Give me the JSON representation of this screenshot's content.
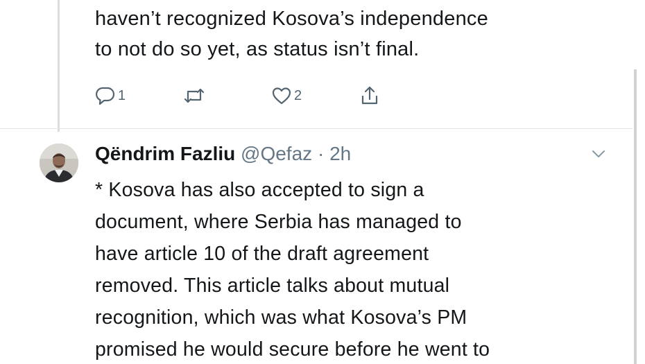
{
  "previous_tweet": {
    "lines": [
      "haven’t recognized Kosova’s independence",
      "to not do so yet, as status isn’t final."
    ],
    "actions": {
      "reply_count": "1",
      "retweet_count": "",
      "like_count": "2"
    }
  },
  "tweet": {
    "author_name": "Qëndrim Fazliu",
    "author_handle": "@Qefaz",
    "separator": " · ",
    "time": "2h",
    "lines": [
      "* Kosova has also accepted to sign a",
      "document, where Serbia has managed to",
      "have article 10 of the draft agreement",
      "removed. This article talks about mutual",
      "recognition, which was what Kosova’s PM",
      "promised he would secure before he went to"
    ]
  },
  "icons": {
    "reply": "reply-icon",
    "retweet": "retweet-icon",
    "like": "heart-icon",
    "share": "share-icon",
    "more": "chevron-down-icon"
  },
  "colors": {
    "text": "#14171a",
    "muted": "#657786",
    "icon": "#536471",
    "background": "#ffffff"
  }
}
